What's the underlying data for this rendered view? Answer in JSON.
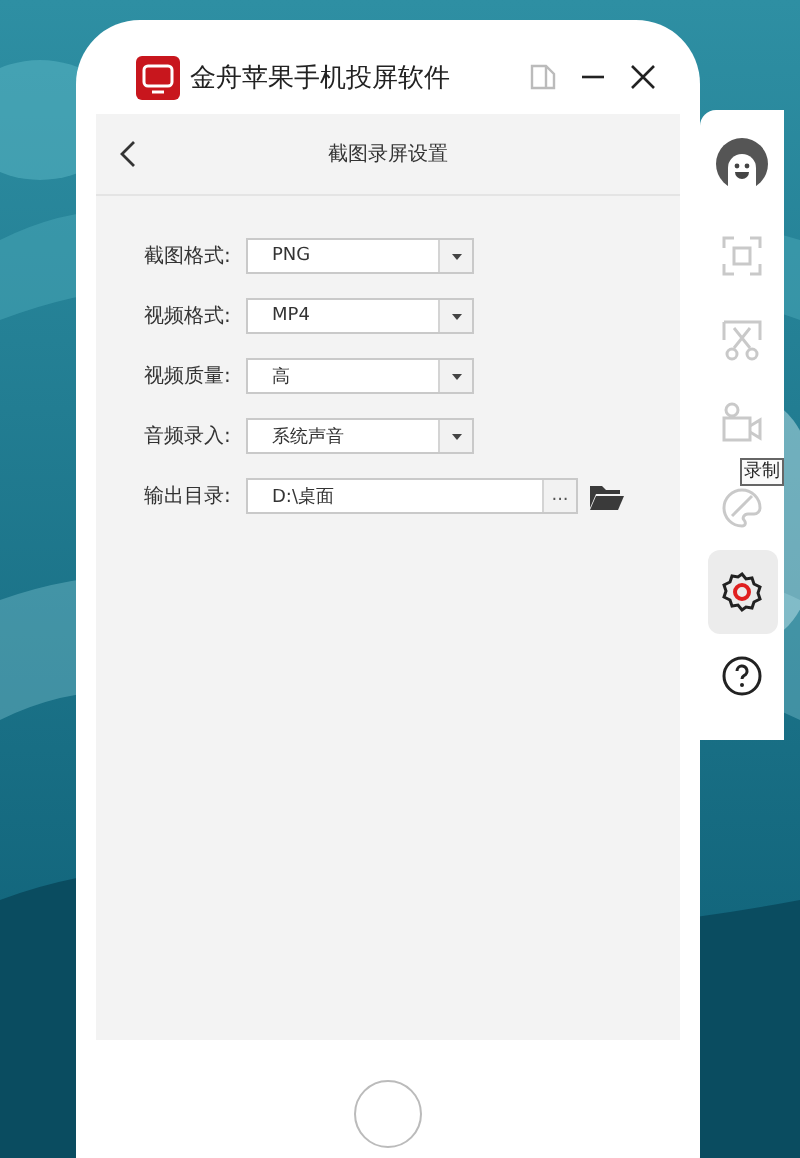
{
  "window": {
    "title": "金舟苹果手机投屏软件"
  },
  "page": {
    "title": "截图录屏设置"
  },
  "settings": [
    {
      "kind": "select",
      "label": "截图格式:",
      "value": "PNG"
    },
    {
      "kind": "select",
      "label": "视频格式:",
      "value": "MP4"
    },
    {
      "kind": "select",
      "label": "视频质量:",
      "value": "高"
    },
    {
      "kind": "select",
      "label": "音频录入:",
      "value": "系统声音"
    },
    {
      "kind": "path",
      "label": "输出目录:",
      "value": "D:\\桌面",
      "button": "..."
    }
  ],
  "sidebar": {
    "items": [
      {
        "kind": "avatar",
        "selected": false,
        "disabled": false
      },
      {
        "kind": "screenshot",
        "selected": false,
        "disabled": true
      },
      {
        "kind": "cut",
        "selected": false,
        "disabled": true
      },
      {
        "kind": "record",
        "selected": false,
        "disabled": true
      },
      {
        "kind": "paint",
        "selected": false,
        "disabled": true
      },
      {
        "kind": "settings",
        "selected": true,
        "disabled": false
      },
      {
        "kind": "help",
        "selected": false,
        "disabled": false
      }
    ]
  },
  "tooltip": {
    "text": "录制"
  }
}
